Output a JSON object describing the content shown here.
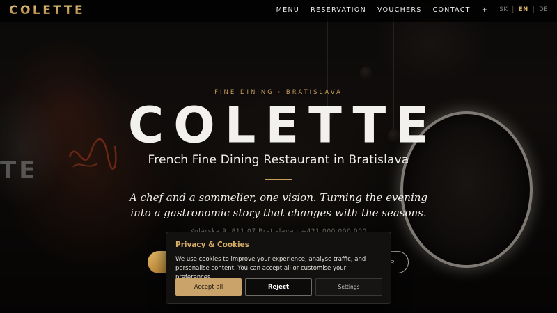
{
  "header": {
    "logo": "COLETTE",
    "nav": [
      "MENU",
      "RESERVATION",
      "VOUCHERS",
      "CONTACT",
      "+"
    ],
    "languages": [
      "SK",
      "EN",
      "DE"
    ],
    "active_language": "EN"
  },
  "hero": {
    "eyebrow": "FINE DINING · BRATISLAVA",
    "title": "COLETTE",
    "subtitle": "French Fine Dining Restaurant in Bratislava",
    "tagline_line1": "A chef and a sommelier, one vision. Turning the evening",
    "tagline_line2": "into a gastronomic story that changes with the seasons.",
    "address_partial": "Kolárska 9, 811 07 Bratislava · +421 000 000 000",
    "cta_secondary_partial": "R",
    "neon_sign_text": "TE"
  },
  "cookie_dialog": {
    "title": "Privacy & Cookies",
    "text": "We use cookies to improve your experience, analyse traffic, and personalise content. You can accept all or customise your preferences.",
    "accept_label": "Accept all",
    "reject_label": "Reject",
    "settings_label": "Settings"
  },
  "colors": {
    "accent_gold": "#c9a05b",
    "cookie_accept_bg": "#c9a36a",
    "background": "#0b0908"
  }
}
